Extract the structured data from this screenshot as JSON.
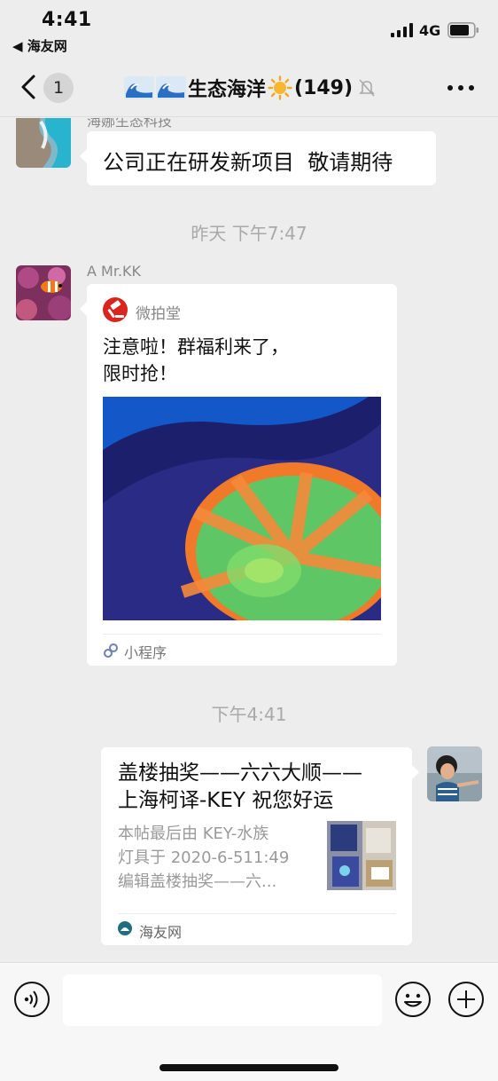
{
  "status_bar": {
    "time": "4:41",
    "back_app_label": "◀ 海友网",
    "network": "4G"
  },
  "nav": {
    "unread_count": "1",
    "title": "生态海洋",
    "member_count": "(149)",
    "icons": [
      "back-chevron-icon",
      "wave-emoji-icon",
      "sun-emoji-icon",
      "bell-mute-icon",
      "more-dots-icon"
    ]
  },
  "messages": {
    "m1": {
      "sender_partial": "海娜生态科技",
      "text": "公司正在研发新项目  敬请期待"
    },
    "ts1": "昨天 下午7:47",
    "m2": {
      "sender": "A  Mr.KK",
      "app_name": "微拍堂",
      "description": "注意啦！群福利来了，\n限时抢！",
      "footer": "小程序"
    },
    "ts2": "下午4:41",
    "m3": {
      "title": "盖楼抽奖——六六大顺——上海柯译-KEY祝您好运",
      "title_line1": "盖楼抽奖——六六大顺——",
      "title_line2": "上海柯译-KEY 祝您好运",
      "desc_line1": "本帖最后由 KEY-水族",
      "desc_line2": "灯具于 2020-6-511:49",
      "desc_line3": "编辑盖楼抽奖——六...",
      "source": "海友网"
    }
  },
  "input_bar": {
    "placeholder": "",
    "icons": [
      "voice-icon",
      "emoji-icon",
      "plus-icon"
    ]
  },
  "colors": {
    "background": "#ededed",
    "bubble": "#ffffff",
    "timestamp": "#a9a9a9",
    "app_red": "#d9251d"
  }
}
